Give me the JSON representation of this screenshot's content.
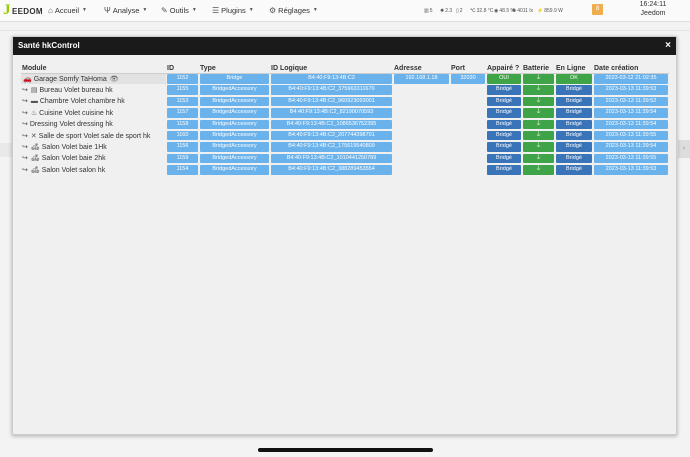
{
  "app": {
    "logo_letter": "J",
    "logo_text": "EEDOM"
  },
  "nav": [
    {
      "name": "nav-accueil",
      "icon": "home-icon",
      "glyph": "⌂",
      "label": "Accueil"
    },
    {
      "name": "nav-analyse",
      "icon": "analysis-icon",
      "glyph": "Ψ",
      "label": "Analyse"
    },
    {
      "name": "nav-outils",
      "icon": "wrench-icon",
      "glyph": "✎",
      "label": "Outils"
    },
    {
      "name": "nav-plugins",
      "icon": "plugins-icon",
      "glyph": "☰",
      "label": "Plugins"
    },
    {
      "name": "nav-reglages",
      "icon": "gear-icon",
      "glyph": "⚙",
      "label": "Réglages"
    }
  ],
  "status": [
    {
      "name": "status-rollers",
      "icon": "roller-icon",
      "glyph": "▥",
      "value": "5"
    },
    {
      "name": "status-lights",
      "icon": "bulb-icon",
      "glyph": "✹",
      "value": "2.3"
    },
    {
      "name": "status-doors",
      "icon": "door-icon",
      "glyph": "▯",
      "value": "2"
    },
    {
      "name": "status-temperature",
      "icon": "thermometer-icon",
      "glyph": "℃",
      "value": "32.8 °C"
    },
    {
      "name": "status-humidity",
      "icon": "drop-icon",
      "glyph": "◉",
      "value": "48.5 %"
    },
    {
      "name": "status-luminosity",
      "icon": "sun-icon",
      "glyph": "✺",
      "value": "4011 lx"
    },
    {
      "name": "status-power",
      "icon": "plug-icon",
      "glyph": "⚡",
      "value": "859.9 W"
    }
  ],
  "badge": "8",
  "clock": {
    "time": "16:24:11",
    "user": "Jeedom"
  },
  "modal": {
    "title": "Santé hkControl",
    "close": "×"
  },
  "columns": [
    "Module",
    "ID",
    "Type",
    "ID Logique",
    "Adresse",
    "Port",
    "Appairé ?",
    "Batterie",
    "En Ligne",
    "Date création"
  ],
  "rows": [
    {
      "module": "Garage Somfy TaHoma",
      "icon": "car-icon",
      "glyph": "🚗",
      "suffix": "👁",
      "child": false,
      "id": "1152",
      "type": "Bridge",
      "logical": "B4:40:F9:13:4B:C2",
      "address": "192.168.1.18",
      "port": "32030",
      "paired": "OUI",
      "paired_color": "#3fa447",
      "battery": "⏚",
      "online": "OK",
      "online_color": "#3fa447",
      "date": "2023-03-12 21:02:35"
    },
    {
      "module": "Bureau Volet bureau hk",
      "icon": "desk-icon",
      "glyph": "▤",
      "child": true,
      "id": "1155",
      "type": "BridgedAccessory",
      "logical": "B4:40:F9:13:4B:C2_375963311670",
      "paired": "Bridgé",
      "battery": "⏚",
      "online": "Bridgé",
      "date": "2023-03-13 11:39:53"
    },
    {
      "module": "Chambre Volet chambre hk",
      "icon": "bed-icon",
      "glyph": "▬",
      "child": true,
      "id": "1153",
      "type": "BridgedAccessory",
      "logical": "B4:40:F9:13:4B:C2_960923093001",
      "paired": "Bridgé",
      "battery": "⏚",
      "online": "Bridgé",
      "date": "2023-03-13 11:39:52"
    },
    {
      "module": "Cuisine Volet cuisine hk",
      "icon": "kitchen-icon",
      "glyph": "♨",
      "child": true,
      "id": "1157",
      "type": "BridgedAccessory",
      "logical": "B4:40:F9:13:4B:C2_82190070593",
      "paired": "Bridgé",
      "battery": "⏚",
      "online": "Bridgé",
      "date": "2023-03-13 11:39:54"
    },
    {
      "module": "Dressing Volet dressing hk",
      "icon": "none",
      "glyph": "",
      "child": true,
      "id": "1158",
      "type": "BridgedAccessory",
      "logical": "B4:40:F9:13:4B:C2_1086536752395",
      "paired": "Bridgé",
      "battery": "⏚",
      "online": "Bridgé",
      "date": "2023-03-13 11:39:54"
    },
    {
      "module": "Salle de sport Volet sale de sport hk",
      "icon": "dumbbell-icon",
      "glyph": "✕",
      "child": true,
      "id": "1160",
      "type": "BridgedAccessory",
      "logical": "B4:40:F9:13:4B:C2_207744398701",
      "paired": "Bridgé",
      "battery": "⏚",
      "online": "Bridgé",
      "date": "2023-03-13 11:39:55"
    },
    {
      "module": "Salon Volet baie 1Hk",
      "icon": "sofa-icon",
      "glyph": "🛋",
      "child": true,
      "id": "1156",
      "type": "BridgedAccessory",
      "logical": "B4:40:F9:13:4B:C2_175619540809",
      "paired": "Bridgé",
      "battery": "⏚",
      "online": "Bridgé",
      "date": "2023-03-13 11:39:54"
    },
    {
      "module": "Salon Volet baie 2hk",
      "icon": "sofa-icon",
      "glyph": "🛋",
      "child": true,
      "id": "1159",
      "type": "BridgedAccessory",
      "logical": "B4:40:F9:13:4B:C2_1010441250789",
      "paired": "Bridgé",
      "battery": "⏚",
      "online": "Bridgé",
      "date": "2023-03-13 11:39:55"
    },
    {
      "module": "Salon Volet salon hk",
      "icon": "sofa-icon",
      "glyph": "🛋",
      "child": true,
      "id": "1154",
      "type": "BridgedAccessory",
      "logical": "B4:40:F9:13:4B:C2_388289453554",
      "paired": "Bridgé",
      "battery": "⏚",
      "online": "Bridgé",
      "date": "2023-03-13 11:39:53"
    }
  ]
}
